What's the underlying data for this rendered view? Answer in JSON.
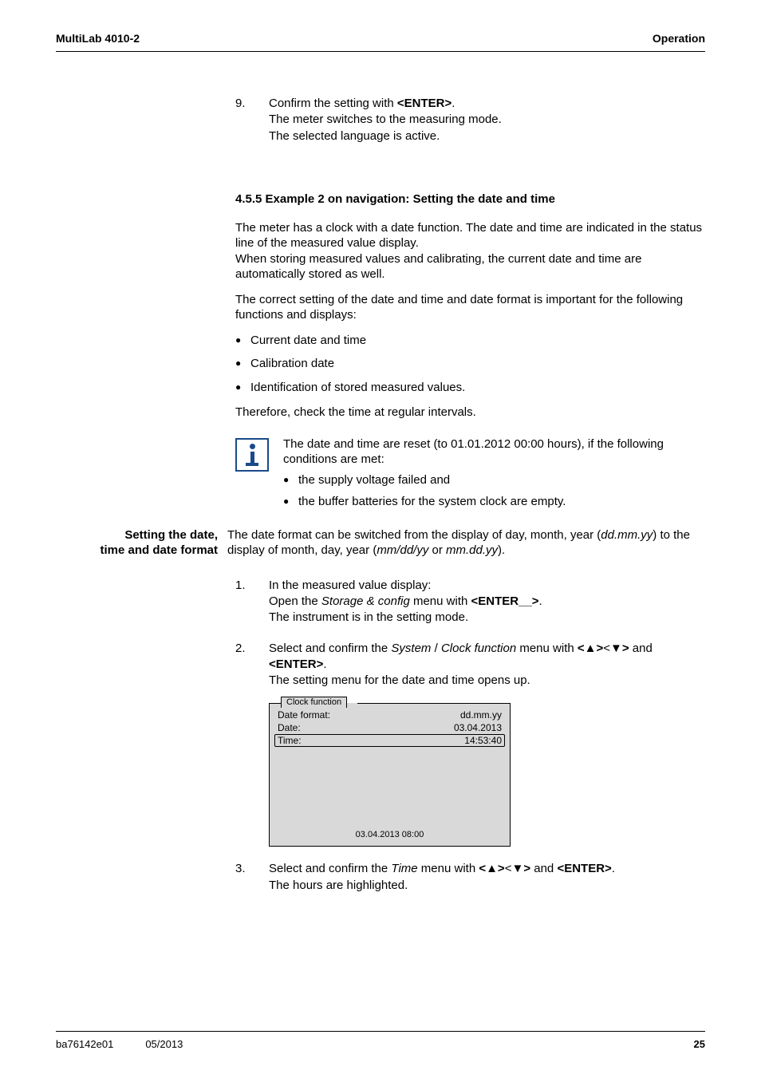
{
  "header": {
    "left": "MultiLab 4010-2",
    "right": "Operation"
  },
  "step9": {
    "num": "9.",
    "line1a": "Confirm the setting with ",
    "line1b": "<ENTER>",
    "line1c": ".",
    "line2": "The meter switches to the measuring mode.",
    "line3": "The selected language is active."
  },
  "section": "4.5.5   Example 2 on navigation: Setting the date and time",
  "para1": "The meter has a clock with a date function. The date and time are indicated in the status line of the measured value display.",
  "para1b": "When storing measured values and calibrating, the current date and time are automatically stored as well.",
  "para2": "The correct setting of the date and time and date format is important for the following functions and displays:",
  "bullets": {
    "b1": "Current date and time",
    "b2": "Calibration date",
    "b3": "Identification of stored measured values."
  },
  "para3": "Therefore, check the time at regular intervals.",
  "info": {
    "intro": "The date and time are reset (to 01.01.2012 00:00 hours), if the following conditions are met:",
    "i1": "the supply voltage failed and",
    "i2": "the buffer batteries for the system clock are empty."
  },
  "sideHeading": {
    "h1": "Setting the date,",
    "h2": "time and date format"
  },
  "sideText": {
    "t1": "The date format can be switched from the display of day, month, year (",
    "t2": "dd.mm.yy",
    "t3": ") to the display of month, day, year (",
    "t4": "mm/dd/yy",
    "t5": " or ",
    "t6": "mm.dd.yy",
    "t7": ")."
  },
  "step1": {
    "num": "1.",
    "l1": "In the measured value display:",
    "l2a": "Open the ",
    "l2b": "Storage & config",
    "l2c": " menu with ",
    "l2d": "<ENTER__>",
    "l2e": ".",
    "l3": "The instrument is in the setting mode."
  },
  "step2": {
    "num": "2.",
    "l1a": "Select and confirm the ",
    "l1b": "System",
    "l1c": " / ",
    "l1d": "Clock function",
    "l1e": " menu with ",
    "l1f": "<▲>",
    "l1g": "<",
    "l1h": "▼>",
    "l1i": " and ",
    "l1j": "<ENTER>",
    "l1k": ".",
    "l2": "The setting menu for the date and time opens up."
  },
  "screen": {
    "tab": "Clock function",
    "r1l": "Date format:",
    "r1r": "dd.mm.yy",
    "r2l": "Date:",
    "r2r": "03.04.2013",
    "r3l": "Time:",
    "r3r": "14:53:40",
    "status": "03.04.2013 08:00"
  },
  "step3": {
    "num": "3.",
    "l1a": "Select and confirm the ",
    "l1b": "Time",
    "l1c": " menu with ",
    "l1d": "<▲>",
    "l1e": "<",
    "l1f": "▼>",
    "l1g": " and ",
    "l1h": "<ENTER>",
    "l1i": ".",
    "l2": "The hours are highlighted."
  },
  "footer": {
    "doc": "ba76142e01",
    "date": "05/2013",
    "page": "25"
  }
}
